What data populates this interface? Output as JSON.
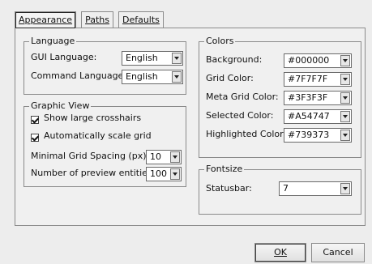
{
  "tabs": [
    {
      "label": "Appearance"
    },
    {
      "label": "Paths"
    },
    {
      "label": "Defaults"
    }
  ],
  "language": {
    "title": "Language",
    "gui_label": "GUI Language:",
    "gui_value": "English",
    "command_label": "Command Language:",
    "command_value": "English"
  },
  "graphic_view": {
    "title": "Graphic View",
    "crosshairs_label": "Show large crosshairs",
    "crosshairs_checked": true,
    "autoscale_label": "Automatically scale grid",
    "autoscale_checked": true,
    "grid_spacing_label": "Minimal Grid Spacing (px):",
    "grid_spacing_value": "10",
    "preview_label": "Number of preview entities:",
    "preview_value": "100"
  },
  "colors": {
    "title": "Colors",
    "items": [
      {
        "label": "Background:",
        "value": "#000000"
      },
      {
        "label": "Grid Color:",
        "value": "#7F7F7F"
      },
      {
        "label": "Meta Grid Color:",
        "value": "#3F3F3F"
      },
      {
        "label": "Selected Color:",
        "value": "#A54747"
      },
      {
        "label": "Highlighted Color:",
        "value": "#739373"
      }
    ]
  },
  "fontsize": {
    "title": "Fontsize",
    "statusbar_label": "Statusbar:",
    "statusbar_value": "7"
  },
  "buttons": {
    "ok": "OK",
    "cancel": "Cancel"
  }
}
